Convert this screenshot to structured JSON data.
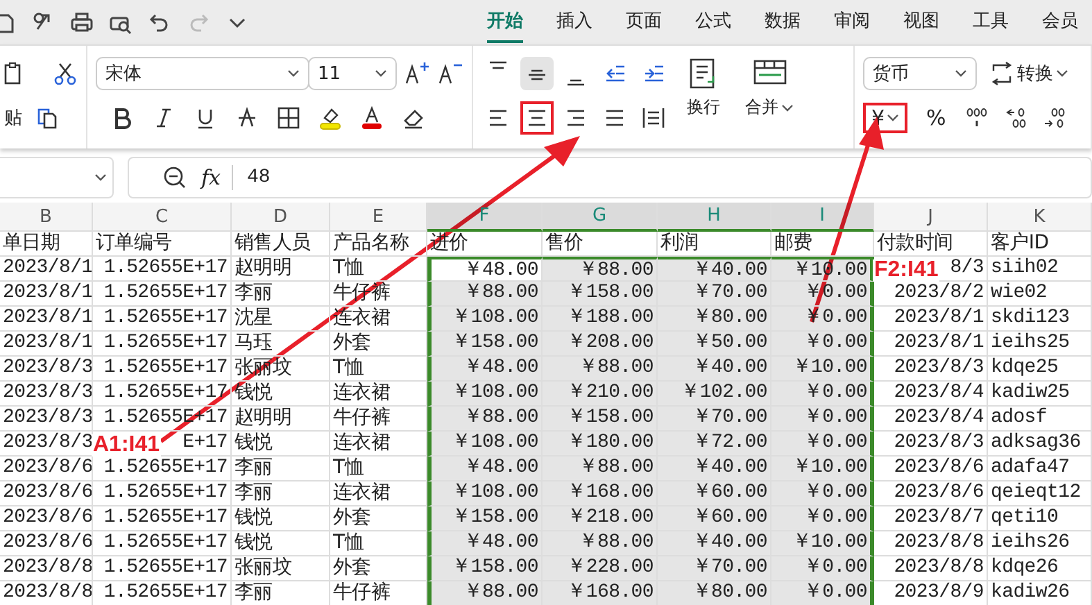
{
  "quick_access": [
    {
      "kind": "save",
      "disabled": false
    },
    {
      "kind": "link",
      "disabled": false
    },
    {
      "kind": "print",
      "disabled": false
    },
    {
      "kind": "preview",
      "disabled": false
    },
    {
      "kind": "undo",
      "disabled": false
    },
    {
      "kind": "redo",
      "disabled": true
    },
    {
      "kind": "more",
      "disabled": false
    }
  ],
  "menu_tabs": [
    {
      "label": "开始",
      "selected": true
    },
    {
      "label": "插入",
      "selected": false
    },
    {
      "label": "页面",
      "selected": false
    },
    {
      "label": "公式",
      "selected": false
    },
    {
      "label": "数据",
      "selected": false
    },
    {
      "label": "审阅",
      "selected": false
    },
    {
      "label": "视图",
      "selected": false
    },
    {
      "label": "工具",
      "selected": false
    },
    {
      "label": "会员",
      "selected": false
    }
  ],
  "clipboard": {
    "paste_label": "贴"
  },
  "font": {
    "family": "宋体",
    "size": "11"
  },
  "alignment": {
    "top_row": [
      {
        "kind": "top",
        "selected": false,
        "annotated": false
      },
      {
        "kind": "middle",
        "selected": true,
        "annotated": false
      },
      {
        "kind": "bottom",
        "selected": false,
        "annotated": false
      },
      {
        "kind": "outdent",
        "selected": false,
        "annotated": false
      },
      {
        "kind": "indent",
        "selected": false,
        "annotated": false
      }
    ],
    "bottom_row": [
      {
        "kind": "left",
        "selected": false,
        "annotated": false
      },
      {
        "kind": "center",
        "selected": false,
        "annotated": true
      },
      {
        "kind": "right",
        "selected": false,
        "annotated": false
      },
      {
        "kind": "justify",
        "selected": false,
        "annotated": false
      },
      {
        "kind": "distributed",
        "selected": false,
        "annotated": false
      }
    ],
    "wrap_label": "换行",
    "merge_label": "合并"
  },
  "number": {
    "format": "货币",
    "convert_label": "转换",
    "currency_symbol": "¥",
    "currency_annotated": true,
    "percent": "%"
  },
  "formula_bar": {
    "fx_label": "fx",
    "value": "48"
  },
  "columns": [
    {
      "letter": "B",
      "heading": "单日期",
      "selected": false
    },
    {
      "letter": "C",
      "heading": "订单编号",
      "selected": false
    },
    {
      "letter": "D",
      "heading": "销售人员",
      "selected": false
    },
    {
      "letter": "E",
      "heading": "产品名称",
      "selected": false
    },
    {
      "letter": "F",
      "heading": "进价",
      "selected": true
    },
    {
      "letter": "G",
      "heading": "售价",
      "selected": true
    },
    {
      "letter": "H",
      "heading": "利润",
      "selected": true
    },
    {
      "letter": "I",
      "heading": "邮费",
      "selected": true
    },
    {
      "letter": "J",
      "heading": "付款时间",
      "selected": false
    },
    {
      "letter": "K",
      "heading": "客户ID",
      "selected": false
    }
  ],
  "rows": [
    {
      "active": true,
      "cells": [
        "2023/8/1",
        "1.52655E+17",
        "赵明明",
        "T恤",
        "￥48.00",
        "￥88.00",
        "￥40.00",
        "￥10.00",
        "8/3",
        "siih02"
      ]
    },
    {
      "active": false,
      "cells": [
        "2023/8/1",
        "1.52655E+17",
        "李丽",
        "牛仔裤",
        "￥88.00",
        "￥158.00",
        "￥70.00",
        "￥0.00",
        "2023/8/2",
        "wie02"
      ]
    },
    {
      "active": false,
      "cells": [
        "2023/8/1",
        "1.52655E+17",
        "沈星",
        "连衣裙",
        "￥108.00",
        "￥188.00",
        "￥80.00",
        "￥0.00",
        "2023/8/1",
        "skdi123"
      ]
    },
    {
      "active": false,
      "cells": [
        "2023/8/1",
        "1.52655E+17",
        "马珏",
        "外套",
        "￥158.00",
        "￥208.00",
        "￥50.00",
        "￥0.00",
        "2023/8/1",
        "ieihs25"
      ]
    },
    {
      "active": false,
      "cells": [
        "2023/8/3",
        "1.52655E+17",
        "张丽坟",
        "T恤",
        "￥48.00",
        "￥88.00",
        "￥40.00",
        "￥10.00",
        "2023/8/3",
        "kdqe25"
      ]
    },
    {
      "active": false,
      "cells": [
        "2023/8/3",
        "1.52655E+17",
        "钱悦",
        "连衣裙",
        "￥108.00",
        "￥210.00",
        "￥102.00",
        "￥0.00",
        "2023/8/4",
        "kadiw25"
      ]
    },
    {
      "active": false,
      "cells": [
        "2023/8/3",
        "1.52655E+17",
        "赵明明",
        "牛仔裤",
        "￥88.00",
        "￥158.00",
        "￥70.00",
        "￥0.00",
        "2023/8/4",
        "adosf"
      ]
    },
    {
      "active": false,
      "cells": [
        "2023/8/3",
        "E+17",
        "钱悦",
        "连衣裙",
        "￥108.00",
        "￥180.00",
        "￥72.00",
        "￥0.00",
        "2023/8/3",
        "adksag36"
      ]
    },
    {
      "active": false,
      "cells": [
        "2023/8/6",
        "1.52655E+17",
        "李丽",
        "T恤",
        "￥48.00",
        "￥88.00",
        "￥40.00",
        "￥10.00",
        "2023/8/6",
        "adafa47"
      ]
    },
    {
      "active": false,
      "cells": [
        "2023/8/6",
        "1.52655E+17",
        "李丽",
        "连衣裙",
        "￥108.00",
        "￥168.00",
        "￥60.00",
        "￥0.00",
        "2023/8/6",
        "qeieqt12"
      ]
    },
    {
      "active": false,
      "cells": [
        "2023/8/6",
        "1.52655E+17",
        "钱悦",
        "外套",
        "￥158.00",
        "￥218.00",
        "￥60.00",
        "￥0.00",
        "2023/8/7",
        "qeti10"
      ]
    },
    {
      "active": false,
      "cells": [
        "2023/8/6",
        "1.52655E+17",
        "钱悦",
        "T恤",
        "￥48.00",
        "￥88.00",
        "￥40.00",
        "￥10.00",
        "2023/8/8",
        "ieihs26"
      ]
    },
    {
      "active": false,
      "cells": [
        "2023/8/8",
        "1.52655E+17",
        "张丽坟",
        "外套",
        "￥158.00",
        "￥228.00",
        "￥70.00",
        "￥0.00",
        "2023/8/8",
        "kdqe26"
      ]
    },
    {
      "active": false,
      "cells": [
        "2023/8/8",
        "1.52655E+17",
        "李丽",
        "牛仔裤",
        "￥88.00",
        "￥168.00",
        "￥80.00",
        "￥0.00",
        "2023/8/9",
        "kadiw26"
      ]
    }
  ],
  "annotations": [
    {
      "label": "A1:I41"
    },
    {
      "label": "F2:I41"
    }
  ]
}
